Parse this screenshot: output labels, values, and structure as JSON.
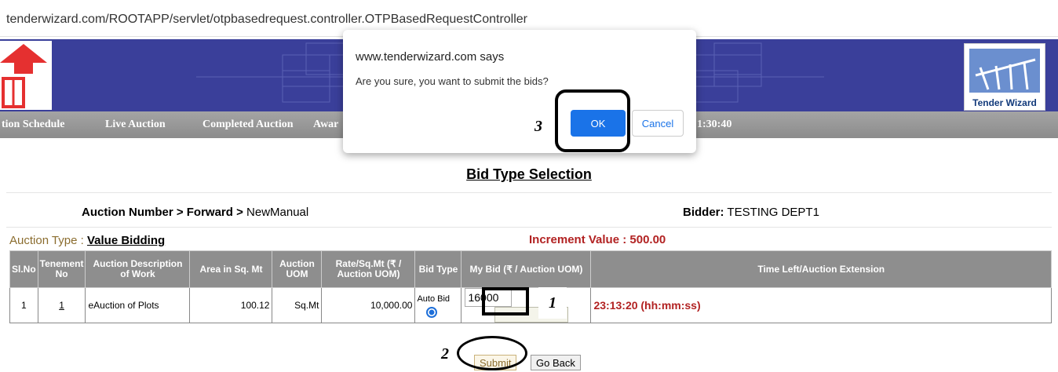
{
  "browser": {
    "url": "tenderwizard.com/ROOTAPP/servlet/otpbasedrequest.controller.OTPBasedRequestController"
  },
  "brand": {
    "right_logo_text": "Tender Wizard"
  },
  "nav": {
    "items": [
      "tion Schedule",
      "Live Auction",
      "Completed Auction",
      "Awar"
    ],
    "timer_fragment": "1:30:40"
  },
  "page": {
    "title": "Bid Type Selection",
    "breadcrumb_prefix": "Auction Number > Forward > ",
    "breadcrumb_value": "NewManual",
    "bidder_label": "Bidder:",
    "bidder_value": "TESTING DEPT1",
    "auction_type_label": "Auction Type :",
    "auction_type_value": "Value Bidding",
    "increment": "Increment Value : 500.00"
  },
  "table": {
    "headers": [
      "Sl.No",
      "Tenement No",
      "Auction Description of Work",
      "Area in Sq. Mt",
      "Auction UOM",
      "Rate/Sq.Mt (₹ / Auction UOM)",
      "Bid Type",
      "My Bid (₹ / Auction UOM)",
      "Time Left/Auction Extension"
    ],
    "row": {
      "slno": "1",
      "tenement": "1",
      "description": "eAuction of Plots",
      "area": "100.12",
      "uom": "Sq.Mt",
      "rate": "10,000.00",
      "bid_type": "Auto Bid",
      "my_bid": "16000",
      "time_left": "23:13:20 (hh:mm:ss)"
    }
  },
  "buttons": {
    "submit": "Submit",
    "go_back": "Go Back"
  },
  "dialog": {
    "title": "www.tenderwizard.com says",
    "message": "Are you sure, you want to submit the bids?",
    "ok": "OK",
    "cancel": "Cancel"
  },
  "annotations": {
    "step1": "1",
    "step2": "2",
    "step3": "3"
  }
}
